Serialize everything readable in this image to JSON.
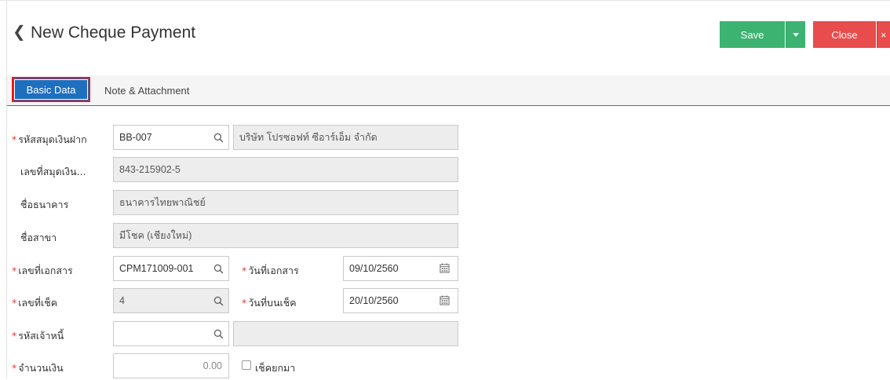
{
  "header": {
    "back_icon": "chevron-left-icon",
    "title": "New Cheque Payment",
    "save_label": "Save",
    "close_label": "Close",
    "close_x": "×",
    "save_color": "#3cb371",
    "close_color": "#e84c4c"
  },
  "tabs": [
    {
      "label": "Basic Data",
      "active": true
    },
    {
      "label": "Note & Attachment",
      "active": false
    }
  ],
  "form": {
    "passbook_code": {
      "label": "รหัสสมุดเงินฝาก",
      "value": "BB-007",
      "name": "บริษัท โปรซอฟท์ ซีอาร์เอ็ม จำกัด"
    },
    "passbook_no": {
      "label": "เลขที่สมุดเงิน...",
      "value": "843-215902-5"
    },
    "bank_name": {
      "label": "ชื่อธนาคาร",
      "value": "ธนาคารไทยพาณิชย์"
    },
    "branch_name": {
      "label": "ชื่อสาขา",
      "value": "มีโชค (เชียงใหม่)"
    },
    "doc_no": {
      "label": "เลขที่เอกสาร",
      "value": "CPM171009-001"
    },
    "doc_date": {
      "label": "วันที่เอกสาร",
      "value": "09/10/2560"
    },
    "cheque_no": {
      "label": "เลขที่เช็ค",
      "value": "4"
    },
    "cheque_date": {
      "label": "วันที่บนเช็ค",
      "value": "20/10/2560"
    },
    "creditor_code": {
      "label": "รหัสเจ้าหนี้",
      "value": "",
      "name": ""
    },
    "amount": {
      "label": "จำนวนเงิน",
      "value": "0.00"
    },
    "carry_forward": {
      "label": "เช็คยกมา",
      "checked": false
    }
  },
  "required_mark": "*"
}
